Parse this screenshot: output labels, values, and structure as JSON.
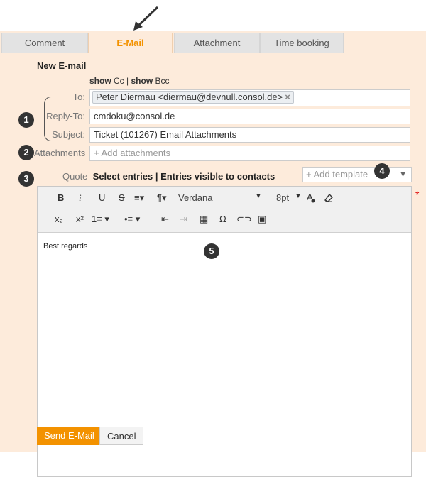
{
  "tabs": [
    {
      "label": "Comment"
    },
    {
      "label": "E-Mail"
    },
    {
      "label": "Attachment"
    },
    {
      "label": "Time booking"
    }
  ],
  "form": {
    "title": "New E-mail",
    "show_cc_bold": "show",
    "show_cc_label": "Cc",
    "separator": "|",
    "show_bcc_bold": "show",
    "show_bcc_label": "Bcc",
    "to_label": "To:",
    "to_recipient": "Peter Diermau <diermau@devnull.consol.de>",
    "token_remove_glyph": "×",
    "replyto_label": "Reply-To:",
    "replyto_value": "cmdoku@consol.de",
    "subject_label": "Subject:",
    "subject_value": "Ticket (101267) Email Attachments",
    "attachments_label": "Attachments",
    "attachments_placeholder": "+ Add attachments",
    "quote_label": "Quote",
    "quote_select": "Select entries",
    "quote_sep": "|",
    "quote_visible": "Entries visible to contacts",
    "template_placeholder": "+ Add template",
    "required_marker": "*"
  },
  "badges": [
    "1",
    "2",
    "3",
    "4",
    "5"
  ],
  "editor": {
    "font_family": "Verdana",
    "font_size": "8pt",
    "body_text": "Best regards",
    "toolbar_row1": [
      "B",
      "i",
      "U",
      "S",
      "≡▾",
      "¶▾"
    ],
    "toolbar_row2": [
      "x₂",
      "x²",
      "1≡ ▾",
      "•≡ ▾",
      "⇤",
      "⇥",
      "▦",
      "Ω",
      "⊂⊃",
      "▣"
    ]
  },
  "actions": {
    "send_label": "Send E-Mail",
    "cancel_label": "Cancel"
  }
}
